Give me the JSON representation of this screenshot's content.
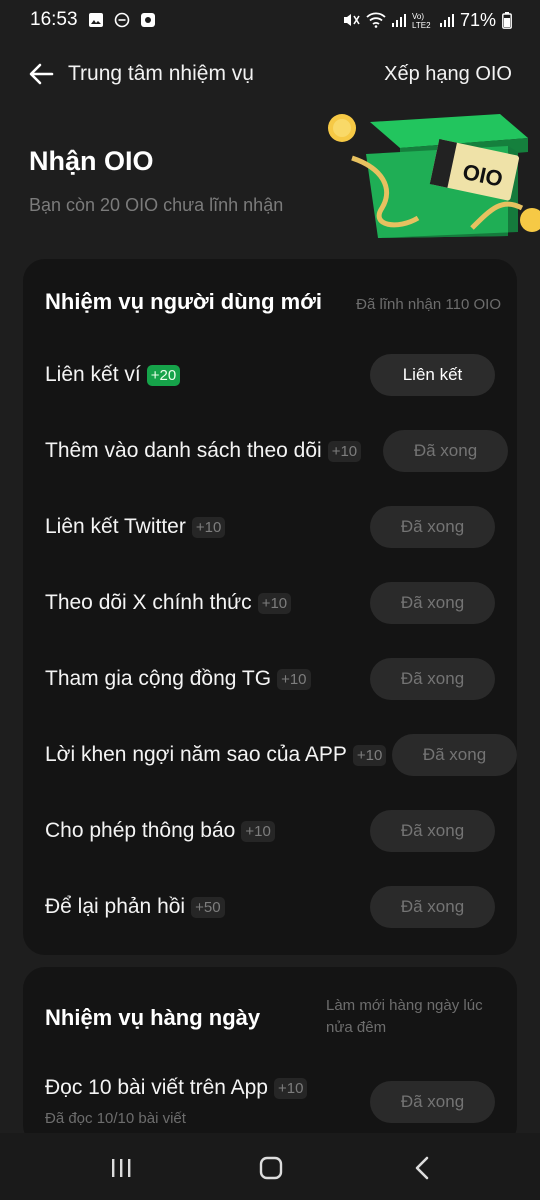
{
  "status_bar": {
    "time": "16:53",
    "battery": "71%"
  },
  "header": {
    "title": "Trung tâm nhiệm vụ",
    "right_link": "Xếp hạng OIO"
  },
  "hero": {
    "title": "Nhận OIO",
    "subtitle": "Bạn còn 20 OIO chưa lĩnh nhận",
    "gift_text": "OIO"
  },
  "new_user_tasks": {
    "title": "Nhiệm vụ người dùng mới",
    "note": "Đã lĩnh nhận 110 OIO",
    "items": [
      {
        "label": "Liên kết ví",
        "reward": "+20",
        "button": "Liên kết"
      },
      {
        "label": "Thêm vào danh sách theo dõi",
        "reward": "+10",
        "button": "Đã xong"
      },
      {
        "label": "Liên kết Twitter",
        "reward": "+10",
        "button": "Đã xong"
      },
      {
        "label": "Theo dõi X chính thức",
        "reward": "+10",
        "button": "Đã xong"
      },
      {
        "label": "Tham gia cộng đồng TG",
        "reward": "+10",
        "button": "Đã xong"
      },
      {
        "label": "Lời khen ngợi năm sao của APP",
        "reward": "+10",
        "button": "Đã xong"
      },
      {
        "label": "Cho phép thông báo",
        "reward": "+10",
        "button": "Đã xong"
      },
      {
        "label": "Để lại phản hồi",
        "reward": "+50",
        "button": "Đã xong"
      }
    ]
  },
  "daily_tasks": {
    "title": "Nhiệm vụ hàng ngày",
    "note": "Làm mới hàng ngày lúc nửa đêm",
    "items": [
      {
        "label": "Đọc 10 bài viết trên App",
        "reward": "+10",
        "sub": "Đã đọc 10/10 bài viết",
        "button": "Đã xong"
      }
    ]
  },
  "colors": {
    "background": "#1e1e1e",
    "card": "#141414",
    "accent_green": "#16a34a",
    "button": "#2a2a2a"
  }
}
